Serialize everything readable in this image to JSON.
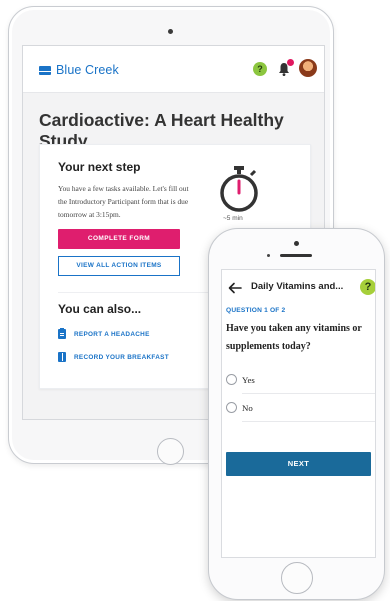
{
  "tablet": {
    "header": {
      "brand": "Blue Creek",
      "help_glyph": "?",
      "icons": [
        "brand-logo-icon",
        "help-icon",
        "bell-icon",
        "avatar"
      ],
      "accent": "#1a73c7",
      "help_color": "#8cc63f",
      "badge_color": "#e0185f"
    },
    "study_title": "Cardioactive: A Heart Healthy Study",
    "next_step": {
      "heading": "Your next step",
      "body": "You have a few tasks available. Let's fill out the Introductory Participant form that is due tomorrow at 3:15pm.",
      "timer_label": "~5 min",
      "timer_icon": "stopwatch-icon",
      "primary_button": "COMPLETE FORM",
      "primary_color": "#df1e6e",
      "secondary_button": "VIEW ALL ACTION ITEMS"
    },
    "also": {
      "heading": "You can also...",
      "items": [
        {
          "icon": "clipboard-icon",
          "label": "REPORT A HEADACHE"
        },
        {
          "icon": "book-icon",
          "label": "RECORD YOUR BREAKFAST"
        }
      ]
    }
  },
  "phone": {
    "title": "Daily Vitamins and...",
    "help_glyph": "?",
    "icons": [
      "back-arrow-icon",
      "help-icon"
    ],
    "question_kicker": "QUESTION 1 OF 2",
    "question": "Have you taken any vitamins or supplements today?",
    "options": [
      "Yes",
      "No"
    ],
    "next_button": "NEXT",
    "next_color": "#1a6a9a"
  }
}
